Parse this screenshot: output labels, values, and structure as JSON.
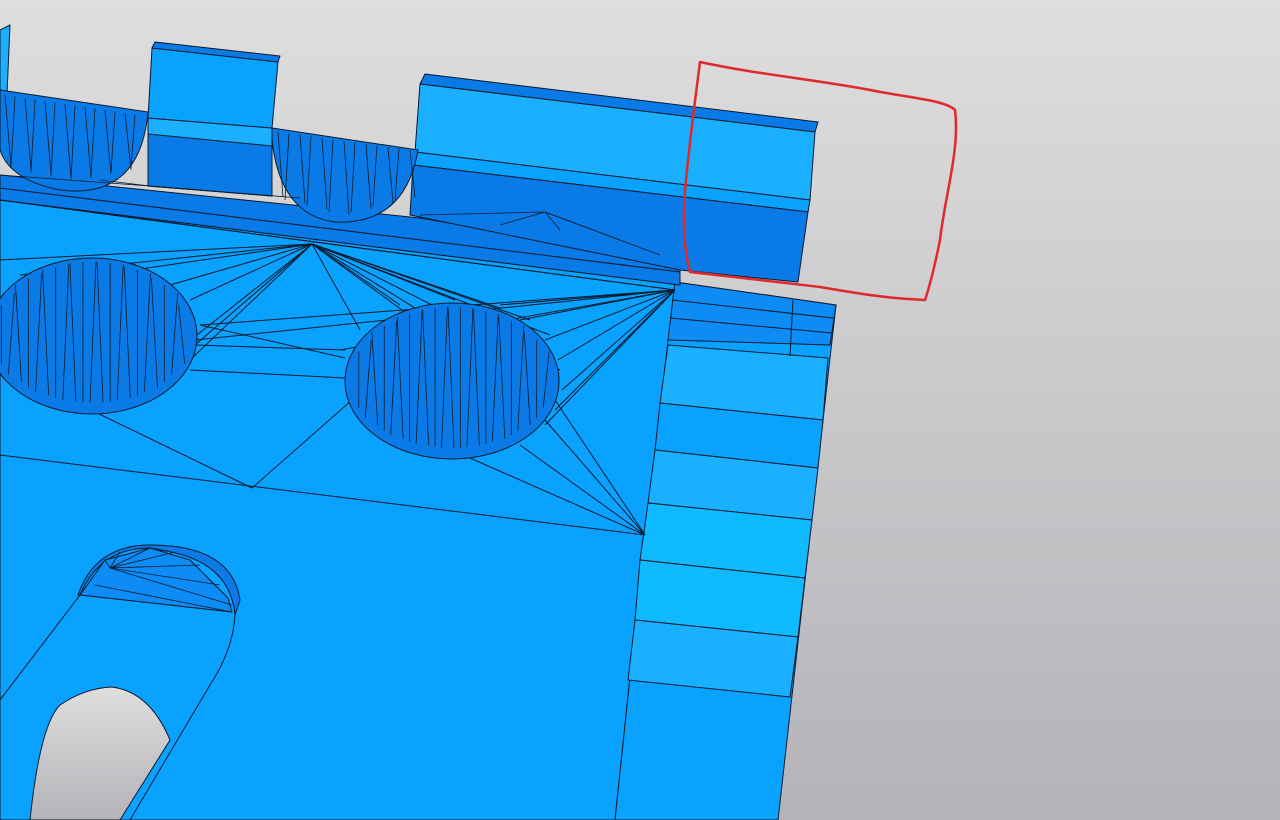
{
  "viewport": {
    "background_top": "#dedede",
    "background_bottom": "#b3b3b8"
  },
  "model": {
    "face_color": "#0aa2ff",
    "face_light": "#1ab0ff",
    "face_dark": "#0a7be6",
    "face_mid": "#0d8cf5",
    "face_highlight": "#0fbaff",
    "edge_color": "#0a1a2e"
  },
  "annotation": {
    "color": "#e0282d"
  }
}
